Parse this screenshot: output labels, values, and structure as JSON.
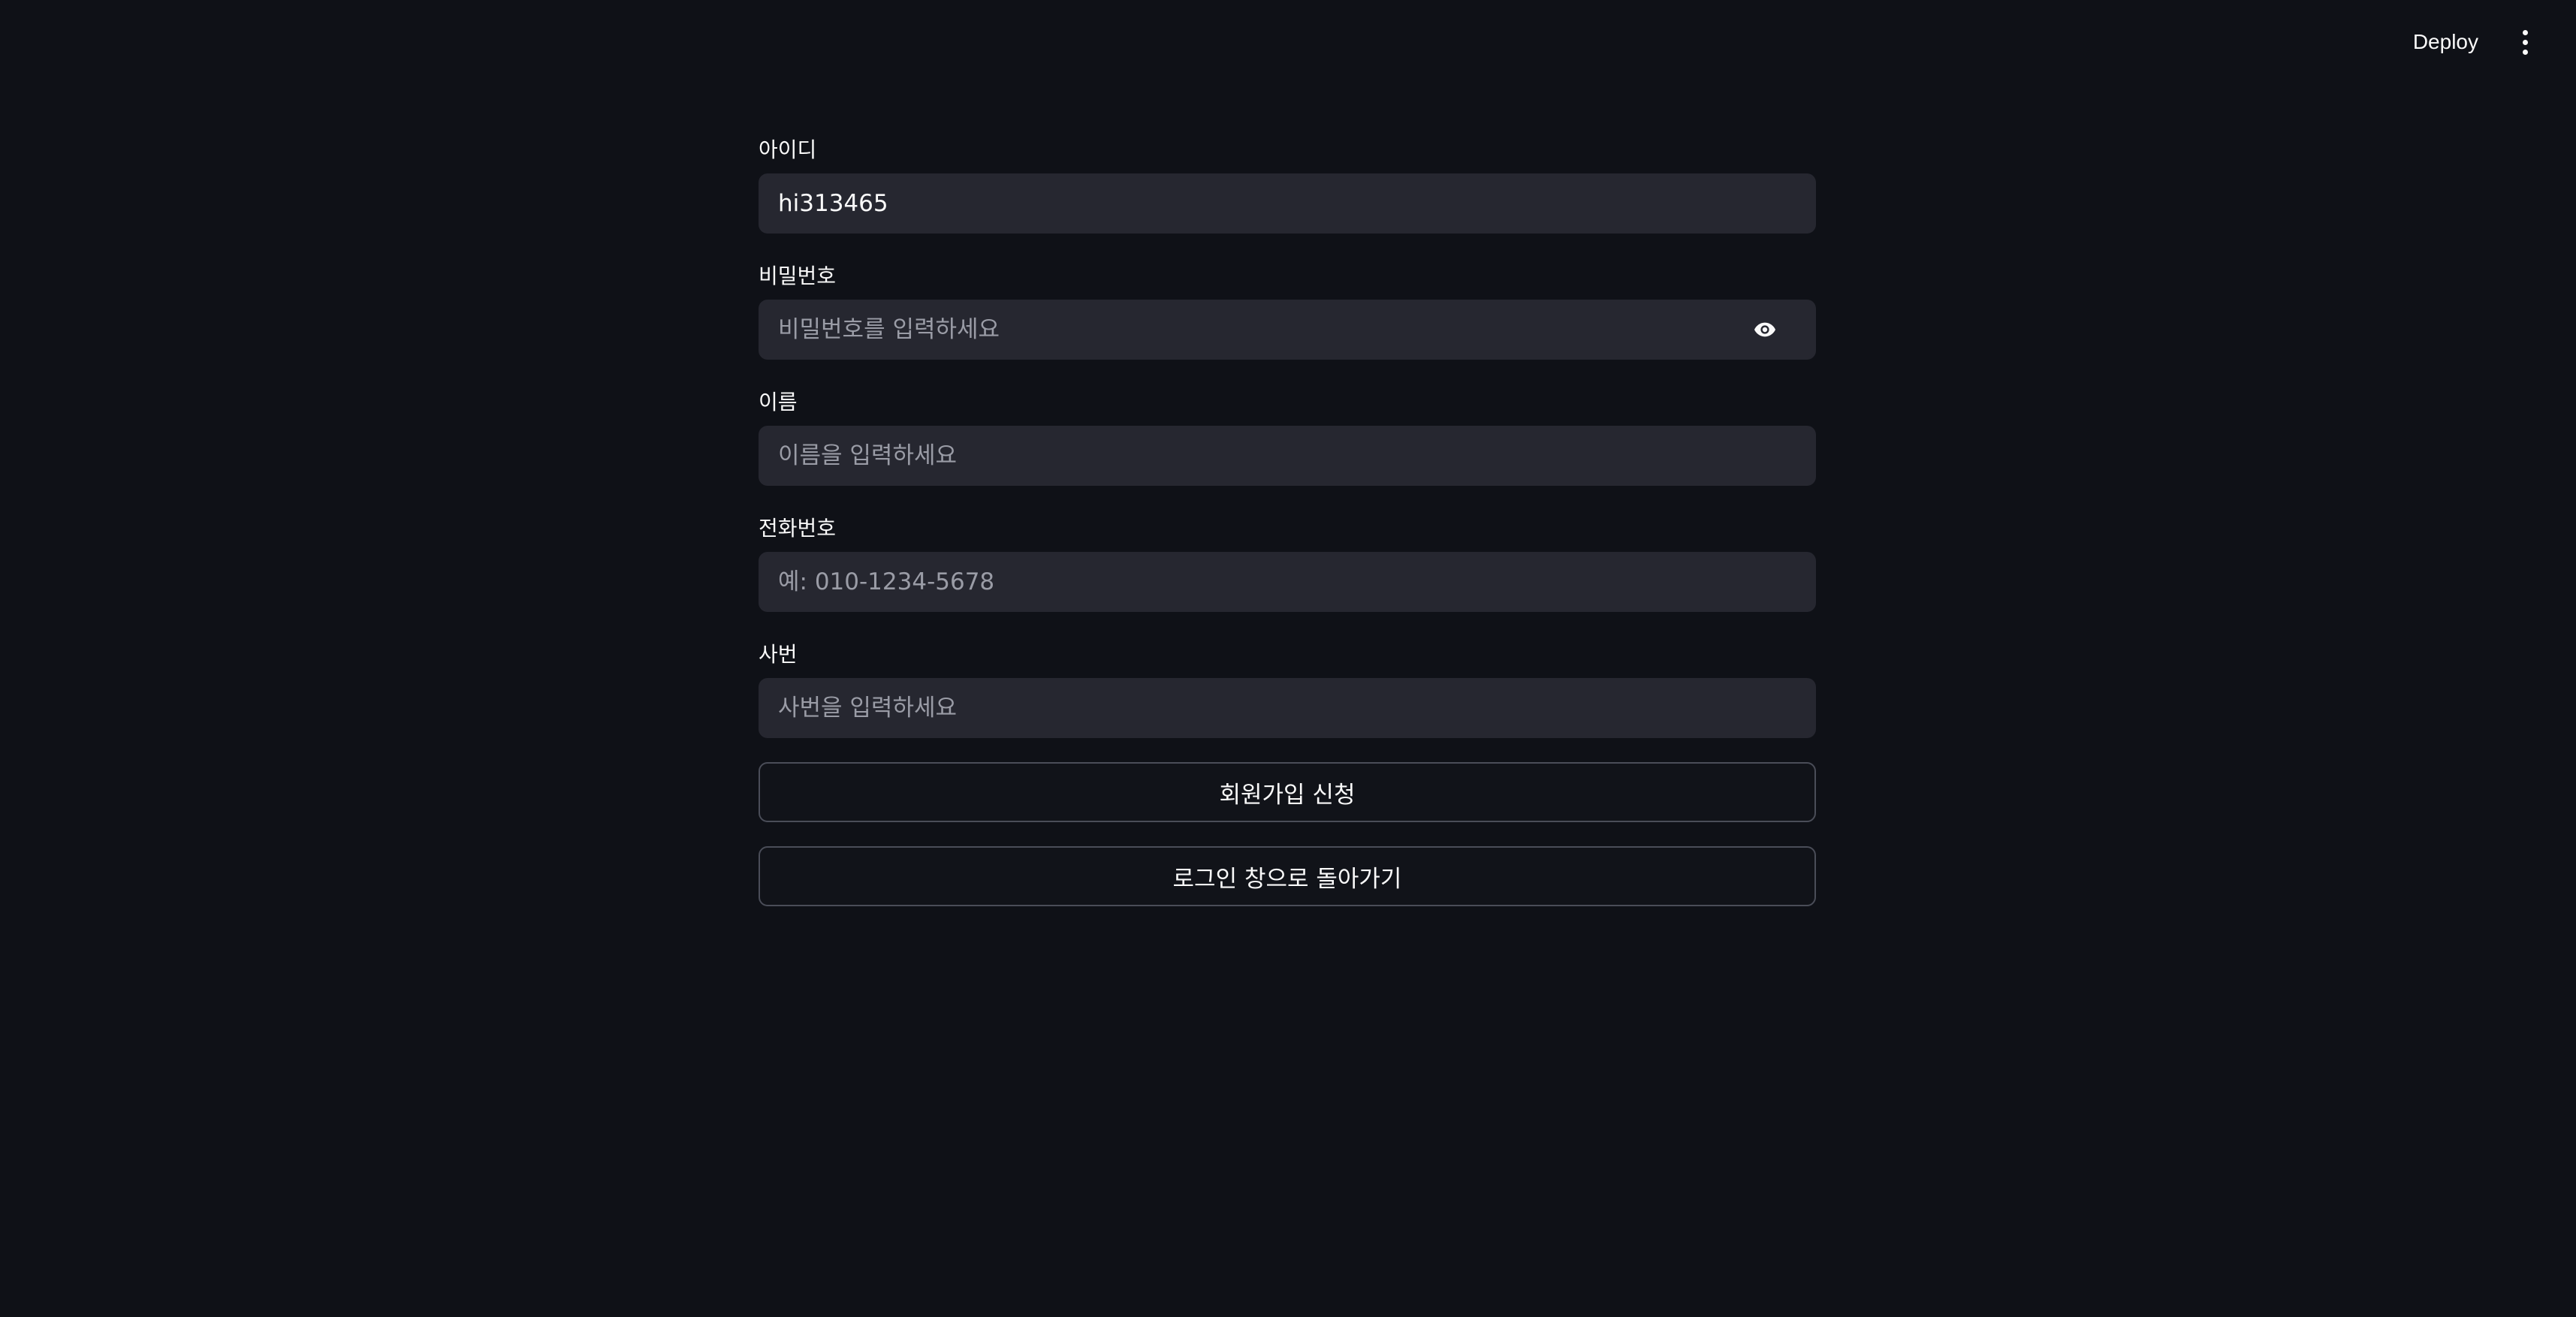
{
  "header": {
    "deploy_label": "Deploy",
    "menu_icon": "more-vertical-icon"
  },
  "form": {
    "id_field": {
      "label": "아이디",
      "value": "hi313465",
      "placeholder": ""
    },
    "password_field": {
      "label": "비밀번호",
      "value": "",
      "placeholder": "비밀번호를 입력하세요",
      "toggle_icon": "eye-icon"
    },
    "name_field": {
      "label": "이름",
      "value": "",
      "placeholder": "이름을 입력하세요"
    },
    "phone_field": {
      "label": "전화번호",
      "value": "",
      "placeholder": "예: 010-1234-5678"
    },
    "employee_id_field": {
      "label": "사번",
      "value": "",
      "placeholder": "사번을 입력하세요"
    },
    "signup_button_label": "회원가입 신청",
    "back_button_label": "로그인 창으로 돌아가기"
  },
  "colors": {
    "background": "#0f1117",
    "input_background": "#262730",
    "text": "#fafafa",
    "placeholder": "#9a9ca6",
    "button_border": "#4a4d58"
  }
}
